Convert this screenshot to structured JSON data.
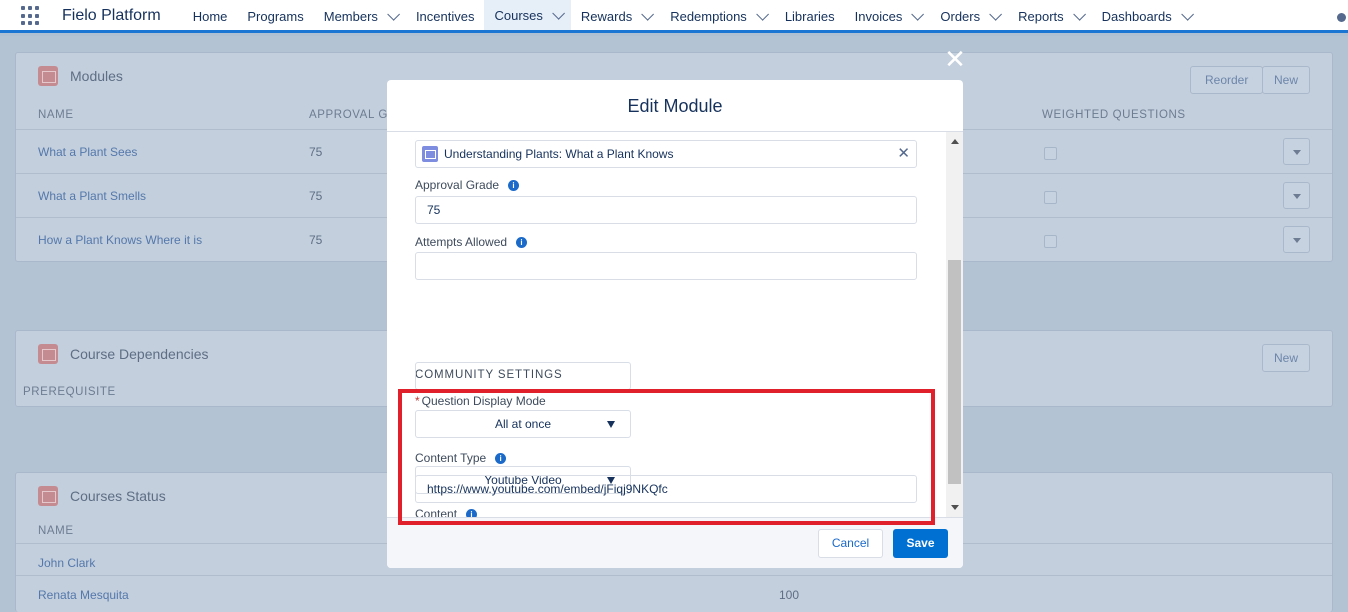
{
  "nav": {
    "app_name": "Fielo Platform",
    "items": [
      {
        "label": "Home",
        "dropdown": false
      },
      {
        "label": "Programs",
        "dropdown": false
      },
      {
        "label": "Members",
        "dropdown": true
      },
      {
        "label": "Incentives",
        "dropdown": false
      },
      {
        "label": "Courses",
        "dropdown": true,
        "active": true
      },
      {
        "label": "Rewards",
        "dropdown": true
      },
      {
        "label": "Redemptions",
        "dropdown": true
      },
      {
        "label": "Libraries",
        "dropdown": false
      },
      {
        "label": "Invoices",
        "dropdown": true
      },
      {
        "label": "Orders",
        "dropdown": true
      },
      {
        "label": "Reports",
        "dropdown": true
      },
      {
        "label": "Dashboards",
        "dropdown": true
      }
    ]
  },
  "modules_card": {
    "title": "Modules",
    "reorder_label": "Reorder",
    "new_label": "New",
    "columns": {
      "name": "NAME",
      "approval": "APPROVAL G",
      "weighted": "WEIGHTED QUESTIONS"
    },
    "rows": [
      {
        "name": "What a Plant Sees",
        "approval": "75"
      },
      {
        "name": "What a Plant Smells",
        "approval": "75"
      },
      {
        "name": "How a Plant Knows Where it is",
        "approval": "75"
      }
    ]
  },
  "dependencies_card": {
    "title": "Course Dependencies",
    "new_label": "New",
    "column": "PREREQUISITE"
  },
  "status_card": {
    "title": "Courses Status",
    "column": "NAME",
    "rows": [
      {
        "name": "John Clark",
        "value": ""
      },
      {
        "name": "Renata Mesquita",
        "value": "100"
      }
    ]
  },
  "modal": {
    "title": "Edit Module",
    "close_symbol": "✕",
    "course_lookup": "Understanding Plants: What a Plant Knows",
    "approval_grade_label": "Approval Grade",
    "approval_grade_value": "75",
    "attempts_label": "Attempts Allowed",
    "attempts_value": "",
    "section_title": "COMMUNITY SETTINGS",
    "required_mark": "*",
    "question_mode_label": "Question Display Mode",
    "question_mode_value": "All at once",
    "content_type_label": "Content Type",
    "content_type_value": "Youtube Video",
    "content_label": "Content",
    "content_value": "https://www.youtube.com/embed/jFiqj9NKQfc",
    "cancel_label": "Cancel",
    "save_label": "Save",
    "highlight_color": "#e0202a"
  }
}
